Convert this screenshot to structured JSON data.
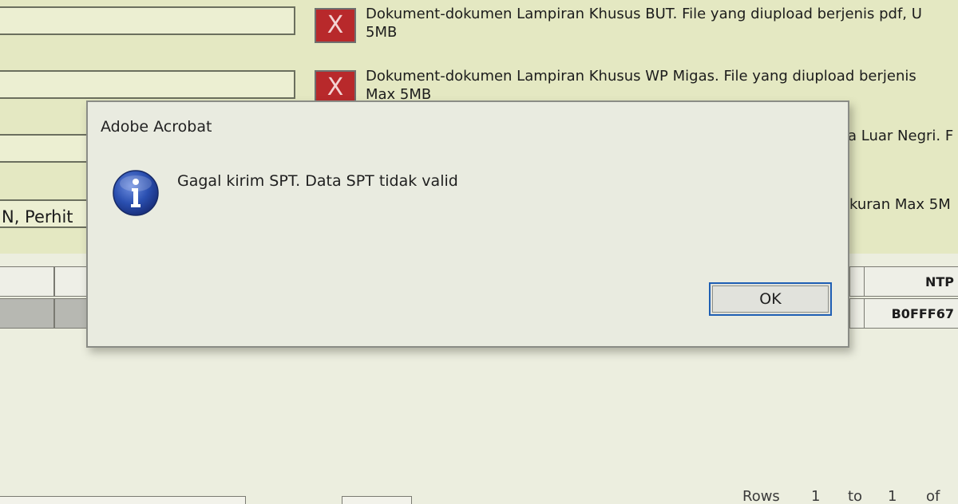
{
  "background_form": {
    "rows": [
      {
        "doc_text_line1": "Dokument-dokumen Lampiran Khusus BUT. File yang diupload berjenis pdf, U",
        "doc_text_line2": "5MB"
      },
      {
        "doc_text_line1": "Dokument-dokumen Lampiran Khusus WP Migas. File yang diupload berjenis",
        "doc_text_line2": "Max 5MB"
      }
    ],
    "remove_button_label": "X",
    "partial_text_right_1": "a Luar Negri. F",
    "partial_text_right_2": "kuran Max 5M",
    "partial_field_text": "N, Perhit"
  },
  "table": {
    "header_ntp": "NTP",
    "row_ntp_value": "B0FFF67"
  },
  "pager": {
    "rows_label": "Rows",
    "from": "1",
    "to_label": "to",
    "to": "1",
    "of_label": "of"
  },
  "dialog": {
    "title": "Adobe Acrobat",
    "message": "Gagal kirim SPT. Data SPT tidak valid",
    "ok_label": "OK",
    "icon": "info-icon"
  },
  "colors": {
    "form_background": "#e4e8c2",
    "remove_button": "#b8292b",
    "dialog_background": "#e9ebe0",
    "ok_focus_border": "#1f5fb4",
    "info_icon_blue": "#1d3f9c"
  }
}
